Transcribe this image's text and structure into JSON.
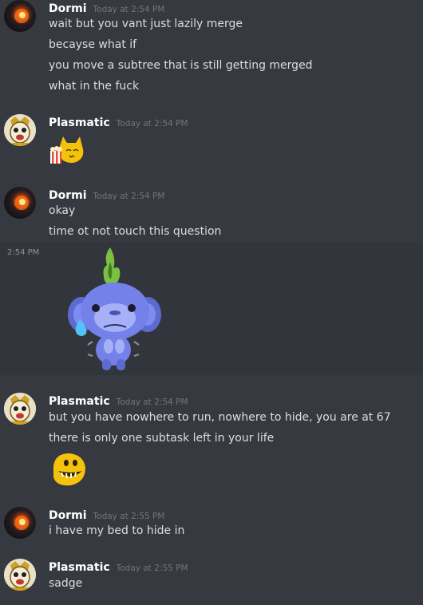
{
  "messages": [
    {
      "user": "Dormi",
      "time": "Today at 2:54 PM",
      "lines": [
        "wait but you vant just lazily merge",
        "becayse what if",
        "you move a subtree that is still getting merged",
        "what in the fuck"
      ]
    },
    {
      "user": "Plasmatic",
      "time": "Today at 2:54 PM",
      "emoji": "popcorn-cat-emoji"
    },
    {
      "user": "Dormi",
      "time": "Today at 2:54 PM",
      "lines": [
        "okay",
        "time ot not touch this question"
      ],
      "sticker_time": "2:54 PM",
      "sticker": "wumpus-sweating-sticker"
    },
    {
      "user": "Plasmatic",
      "time": "Today at 2:54 PM",
      "lines": [
        "but you have nowhere to run, nowhere to hide, you are at 67",
        "there is only one subtask left in your life"
      ],
      "emoji": "grinning-face-emoji"
    },
    {
      "user": "Dormi",
      "time": "Today at 2:55 PM",
      "lines": [
        "i have my bed to hide in"
      ]
    },
    {
      "user": "Plasmatic",
      "time": "Today at 2:55 PM",
      "lines": [
        "sadge"
      ]
    }
  ],
  "colors": {
    "background": "#36393f",
    "sticker_band": "#32353b",
    "username": "#ffffff",
    "timestamp": "#72767d",
    "text": "#dcddde"
  }
}
